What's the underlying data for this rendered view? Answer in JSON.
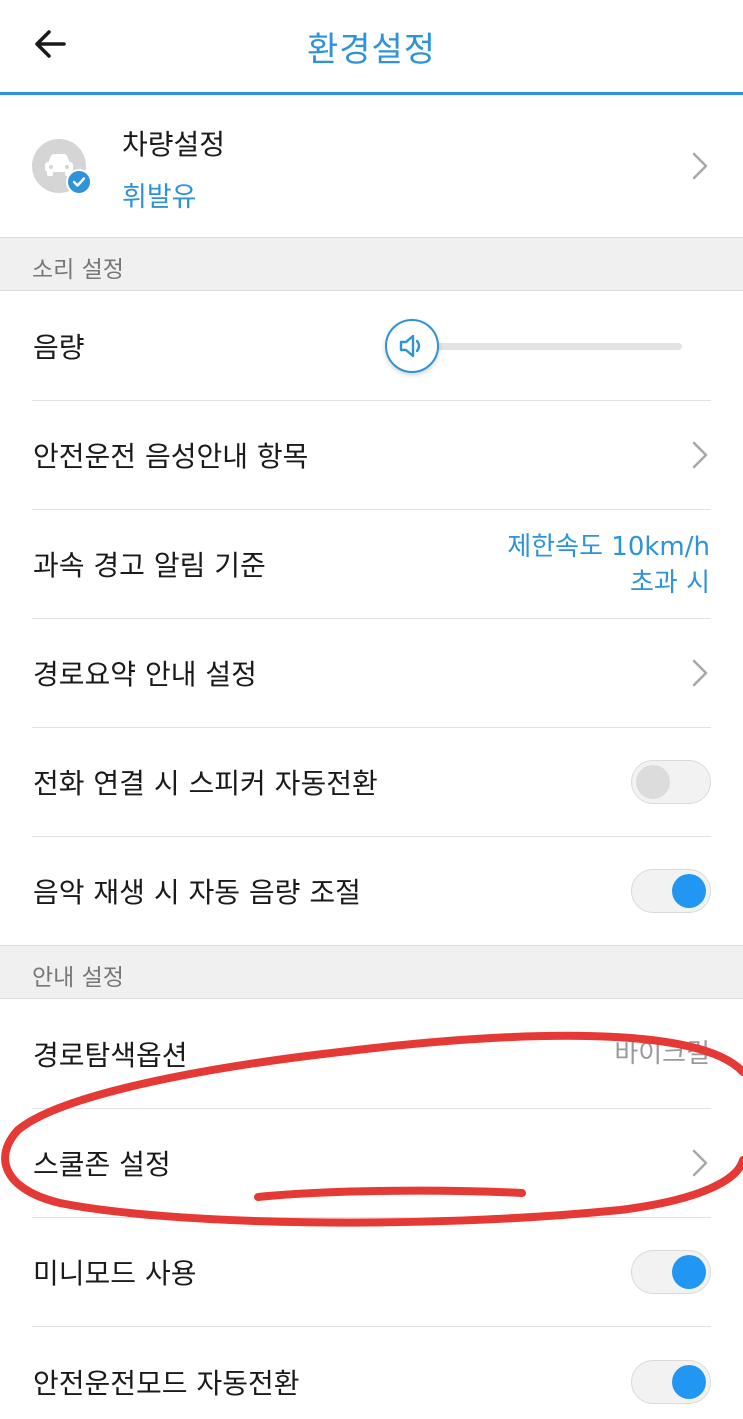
{
  "header": {
    "title": "환경설정",
    "back_icon": "arrow-left-icon"
  },
  "vehicle": {
    "title": "차량설정",
    "fuel": "휘발유"
  },
  "sections": {
    "sound": "소리 설정",
    "guide": "안내 설정"
  },
  "rows": {
    "volume": {
      "label": "음량",
      "level": 0
    },
    "safe_voice": {
      "label": "안전운전 음성안내 항목"
    },
    "speed_alert": {
      "label": "과속 경고 알림 기준",
      "value_line1": "제한속도 10km/h",
      "value_line2": "초과 시"
    },
    "route_summary": {
      "label": "경로요약 안내 설정"
    },
    "call_speaker": {
      "label": "전화 연결 시 스피커 자동전환",
      "on": false
    },
    "music_volume": {
      "label": "음악 재생 시 자동 음량 조절",
      "on": true
    },
    "route_option": {
      "label": "경로탐색옵션",
      "value": "바이크길"
    },
    "school_zone": {
      "label": "스쿨존 설정"
    },
    "mini_mode": {
      "label": "미니모드 사용",
      "on": true
    },
    "safe_mode": {
      "label": "안전운전모드 자동전환",
      "on": true
    }
  },
  "colors": {
    "accent": "#2e93d8",
    "toggle_on": "#2196f3",
    "annotation": "#e53935"
  }
}
